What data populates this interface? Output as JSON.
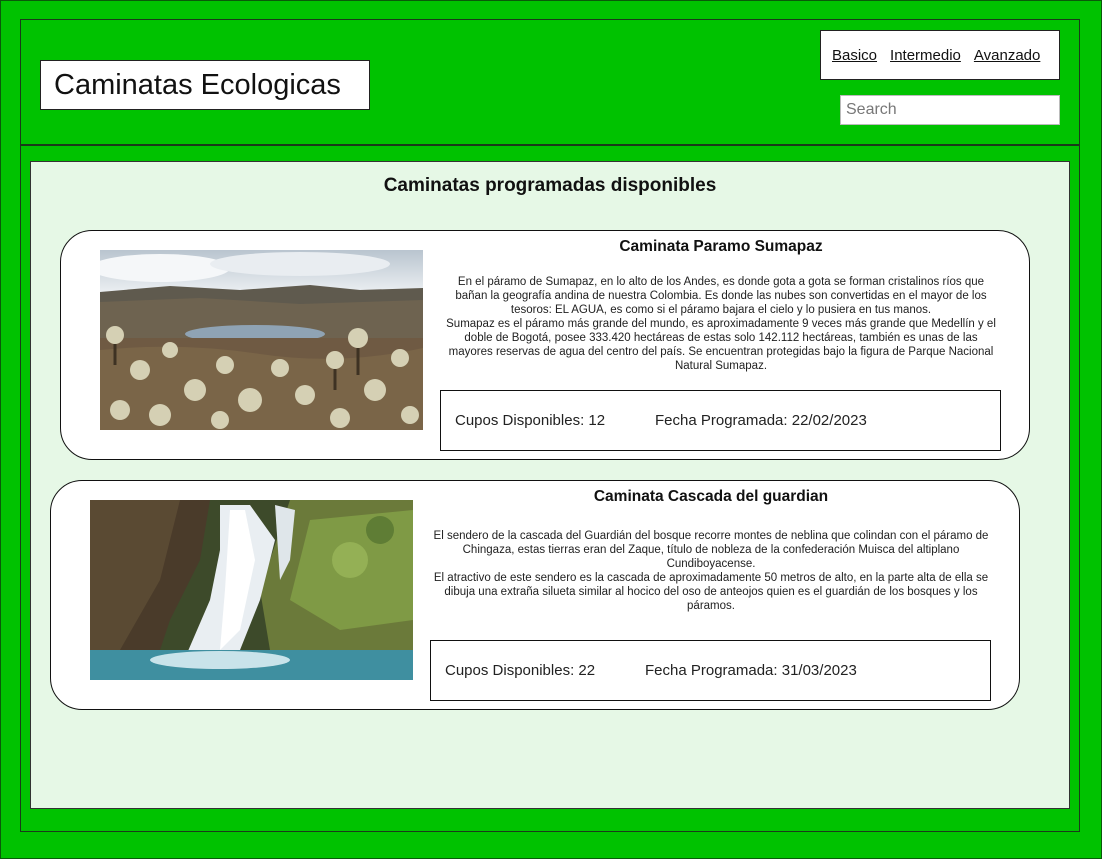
{
  "app": {
    "title": "Caminatas Ecologicas"
  },
  "nav": {
    "items": [
      {
        "label": "Basico"
      },
      {
        "label": "Intermedio"
      },
      {
        "label": "Avanzado"
      }
    ]
  },
  "search": {
    "placeholder": "Search",
    "value": "",
    "icon": "search-icon"
  },
  "main": {
    "title": "Caminatas programadas disponibles",
    "cards": [
      {
        "title": "Caminata Paramo Sumapaz",
        "image_subject": "Páramo landscape with frailejones and a lagoon",
        "description": [
          "En el páramo de Sumapaz, en lo alto de los Andes, es donde gota a gota se forman cristalinos ríos que bañan la geografía andina de nuestra Colombia. Es donde las nubes son convertidas en el mayor de los tesoros: EL AGUA, es como si el páramo bajara el cielo y lo pusiera en tus manos.",
          "Sumapaz es el páramo más grande del mundo, es aproximadamente 9 veces más grande que Medellín y el doble de Bogotá, posee 333.420 hectáreas de estas solo 142.112 hectáreas, también es unas de las mayores reservas de agua del centro del país. Se encuentran protegidas bajo la figura de Parque Nacional Natural Sumapaz."
        ],
        "cupos": "Cupos Disponibles: 12",
        "fecha": "Fecha Programada: 22/02/2023"
      },
      {
        "title": "Caminata Cascada del guardian",
        "image_subject": "Waterfall over mossy rocks",
        "description": [
          "El sendero de la cascada del Guardián del bosque recorre montes de neblina que colindan con el páramo de Chingaza, estas tierras eran del Zaque, título de nobleza de la confederación Muisca del altiplano Cundiboyacense.",
          "El atractivo de este sendero es la cascada de aproximadamente 50 metros de alto, en la parte alta de ella se dibuja una extraña silueta similar al hocico del oso de anteojos quien es el guardián de los bosques y los páramos."
        ],
        "cupos": "Cupos Disponibles: 22",
        "fecha": "Fecha Programada: 31/03/2023"
      }
    ]
  },
  "colors": {
    "background": "#00c200",
    "content_panel": "#e6f8e6",
    "card": "#ffffff",
    "border": "#111111"
  }
}
